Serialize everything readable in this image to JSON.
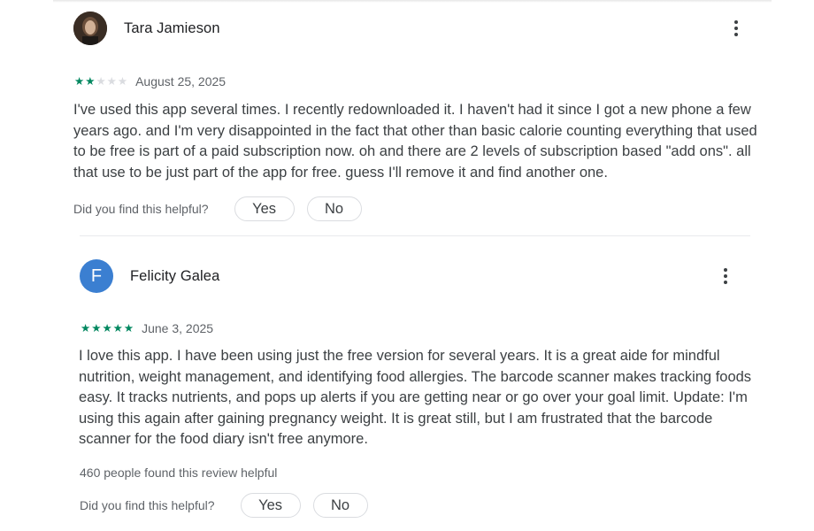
{
  "reviews": [
    {
      "reviewer": "Tara Jamieson",
      "avatar_initial": "",
      "rating": 2,
      "date": "August 25, 2025",
      "text": "I've used this app several times. I recently redownloaded it. I haven't had it since I got a new phone a few years ago. and I'm very disappointed in the fact that other than basic calorie counting everything that used to be free is part of a paid subscription now. oh and there are 2 levels of subscription based \"add ons\". all that use to be just part of the app for free. guess I'll remove it and find another one.",
      "helpful_count": "",
      "helpful_question": "Did you find this helpful?",
      "yes_label": "Yes",
      "no_label": "No"
    },
    {
      "reviewer": "Felicity Galea",
      "avatar_initial": "F",
      "avatar_color": "#3b7fd1",
      "rating": 5,
      "date": "June 3, 2025",
      "text": "I love this app. I have been using just the free version for several years. It is a great aide for mindful nutrition, weight management, and identifying food allergies. The barcode scanner makes tracking foods easy. It tracks nutrients, and pops up alerts if you are getting near or go over your goal limit. Update: I'm using this again after gaining pregnancy weight. It is great still, but I am frustrated that the barcode scanner for the food diary isn't free anymore.",
      "helpful_count": "460 people found this review helpful",
      "helpful_question": "Did you find this helpful?",
      "yes_label": "Yes",
      "no_label": "No"
    }
  ],
  "icons": {
    "more": "more-vert-icon",
    "star": "star-icon"
  },
  "colors": {
    "star_filled": "#01875f",
    "star_empty": "#dadce0",
    "avatar_letter_bg": "#3b7fd1"
  }
}
